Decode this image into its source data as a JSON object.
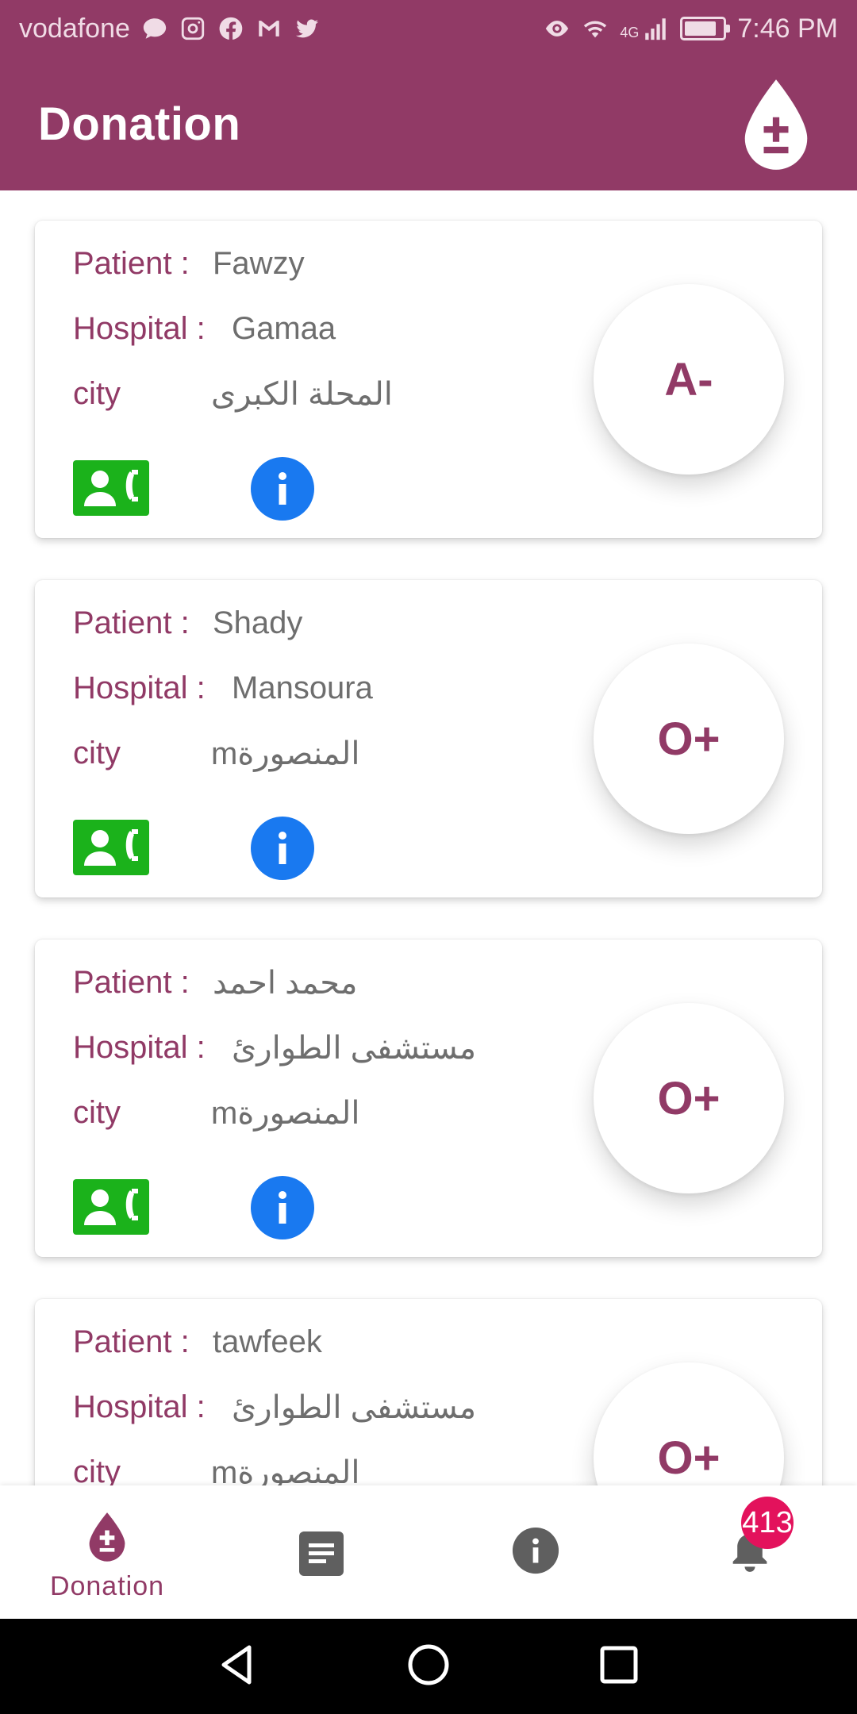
{
  "status_bar": {
    "carrier": "vodafone",
    "network": "4G",
    "time": "7:46 PM",
    "battery_level": 0.85,
    "left_icons": [
      "message-icon",
      "instagram-icon",
      "facebook-icon",
      "gmail-icon",
      "twitter-icon"
    ],
    "right_icons": [
      "eye-icon",
      "wifi-icon",
      "signal-icon",
      "battery-icon"
    ]
  },
  "app_bar": {
    "title": "Donation",
    "action_icon": "blood-drop-plus-minus-icon"
  },
  "labels": {
    "patient": "Patient :",
    "hospital": "Hospital :",
    "city": "city"
  },
  "donations": [
    {
      "patient": "Fawzy",
      "hospital": "Gamaa",
      "city": "المحلة الكبرى",
      "blood_type": "A-"
    },
    {
      "patient": "Shady",
      "hospital": "Mansoura",
      "city": "mالمنصورة",
      "blood_type": "O+"
    },
    {
      "patient": "محمد احمد",
      "hospital": "مستشفى الطوارئ",
      "city": "mالمنصورة",
      "blood_type": "O+"
    },
    {
      "patient": "tawfeek",
      "hospital": "مستشفى الطوارئ",
      "city": "mالمنصورة",
      "blood_type": "O+"
    }
  ],
  "bottom_nav": {
    "items": [
      {
        "label": "Donation",
        "icon": "blood-drop-icon",
        "active": true
      },
      {
        "label": "",
        "icon": "notes-icon",
        "active": false
      },
      {
        "label": "",
        "icon": "info-icon",
        "active": false
      },
      {
        "label": "",
        "icon": "bell-icon",
        "active": false
      }
    ],
    "notification_count": "413"
  },
  "colors": {
    "primary": "#913a66",
    "call_green": "#1bb21b",
    "info_blue": "#1979f0",
    "badge_red": "#e3125c"
  }
}
